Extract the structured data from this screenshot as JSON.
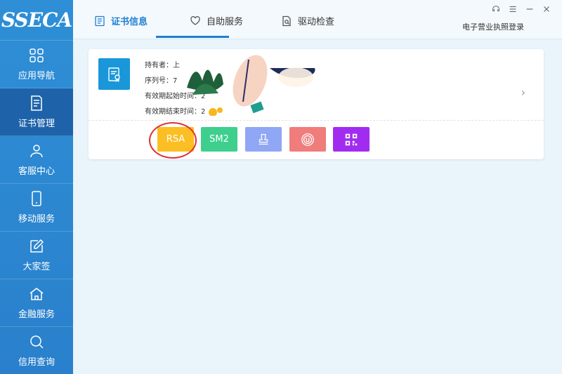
{
  "app": {
    "logo_text": "SSECA"
  },
  "sidebar": {
    "items": [
      {
        "label": "应用导航",
        "icon": "grid-icon"
      },
      {
        "label": "证书管理",
        "icon": "certificate-doc-icon",
        "active": true
      },
      {
        "label": "客服中心",
        "icon": "user-icon"
      },
      {
        "label": "移动服务",
        "icon": "mobile-icon"
      },
      {
        "label": "大家签",
        "icon": "edit-icon"
      },
      {
        "label": "金融服务",
        "icon": "bank-icon"
      },
      {
        "label": "信用查询",
        "icon": "search-icon"
      }
    ]
  },
  "tabs": [
    {
      "label": "证书信息",
      "icon": "doc-list-icon",
      "active": true
    },
    {
      "label": "自助服务",
      "icon": "heart-hand-icon"
    },
    {
      "label": "驱动检查",
      "icon": "doc-search-icon"
    }
  ],
  "header": {
    "license_login": "电子营业执照登录"
  },
  "window_controls": [
    "support-icon",
    "menu-icon",
    "minimize-icon",
    "close-icon"
  ],
  "card": {
    "holder_label": "持有者：上",
    "serial_label": "序列号：7",
    "valid_from_label": "有效期起始时间：2",
    "valid_to_label": "有效期结束时间：2",
    "buttons": [
      {
        "label": "RSA",
        "color": "#fbbf24"
      },
      {
        "label": "SM2",
        "color": "#3ecf8e"
      },
      {
        "label": "",
        "icon": "stamp-icon",
        "color": "#8fa7f5"
      },
      {
        "label": "",
        "icon": "seal-icon",
        "color": "#f07c7c"
      },
      {
        "label": "",
        "icon": "qrcode-icon",
        "color": "#a12cf0"
      }
    ]
  },
  "colors": {
    "accent": "#1f7fd0",
    "sidebar": "#2a80cc",
    "sidebar_active": "#1e63aa",
    "highlight_circle": "#e03131"
  }
}
